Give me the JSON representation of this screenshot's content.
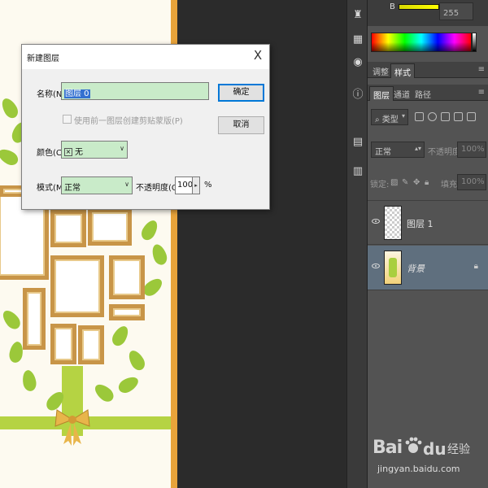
{
  "dialog": {
    "title": "新建图层",
    "name_label": "名称(N):",
    "name_value": "图层 0",
    "clip_label": "使用前一图层创建剪贴蒙版(P)",
    "color_label": "颜色(C):",
    "color_value": "无",
    "mode_label": "模式(M):",
    "mode_value": "正常",
    "opacity_label": "不透明度(O):",
    "opacity_value": "100",
    "opacity_unit": "%",
    "ok_label": "确定",
    "cancel_label": "取消",
    "close_glyph": "X"
  },
  "color_panel": {
    "channel_label": "B",
    "channel_value": "255",
    "brightness_level": 1.0
  },
  "panel_tabs_top": [
    {
      "label": "调整",
      "active": false
    },
    {
      "label": "样式",
      "active": true
    }
  ],
  "panel_tabs_layers": [
    {
      "label": "图层",
      "active": true
    },
    {
      "label": "通道",
      "active": false
    },
    {
      "label": "路径",
      "active": false
    }
  ],
  "layers_panel": {
    "filter_value": "类型",
    "blend_mode": "正常",
    "opacity_label": "不透明度:",
    "opacity_value": "100%",
    "lock_label": "锁定:",
    "fill_label": "填充:",
    "fill_value": "100%",
    "layers": [
      {
        "name": "图层 1",
        "selected": false,
        "locked": false,
        "thumb": "transparent"
      },
      {
        "name": "背景",
        "selected": true,
        "locked": true,
        "thumb": "background"
      }
    ]
  },
  "tool_icons": [
    "castle-icon",
    "grid-icon",
    "swatches-icon",
    "info-icon",
    "notes-icon",
    "history-icon"
  ],
  "watermark": {
    "brand": "Bai",
    "brand_suffix": "du",
    "product": "经验",
    "url": "jingyan.baidu.com"
  },
  "colors": {
    "accent_blue": "#3370d0",
    "input_green": "#c9ebc9",
    "panel_bg": "#535353",
    "selected_layer": "#5f6f7e",
    "frame_gold": "#c89548",
    "leaf_green": "#9bc83a"
  }
}
